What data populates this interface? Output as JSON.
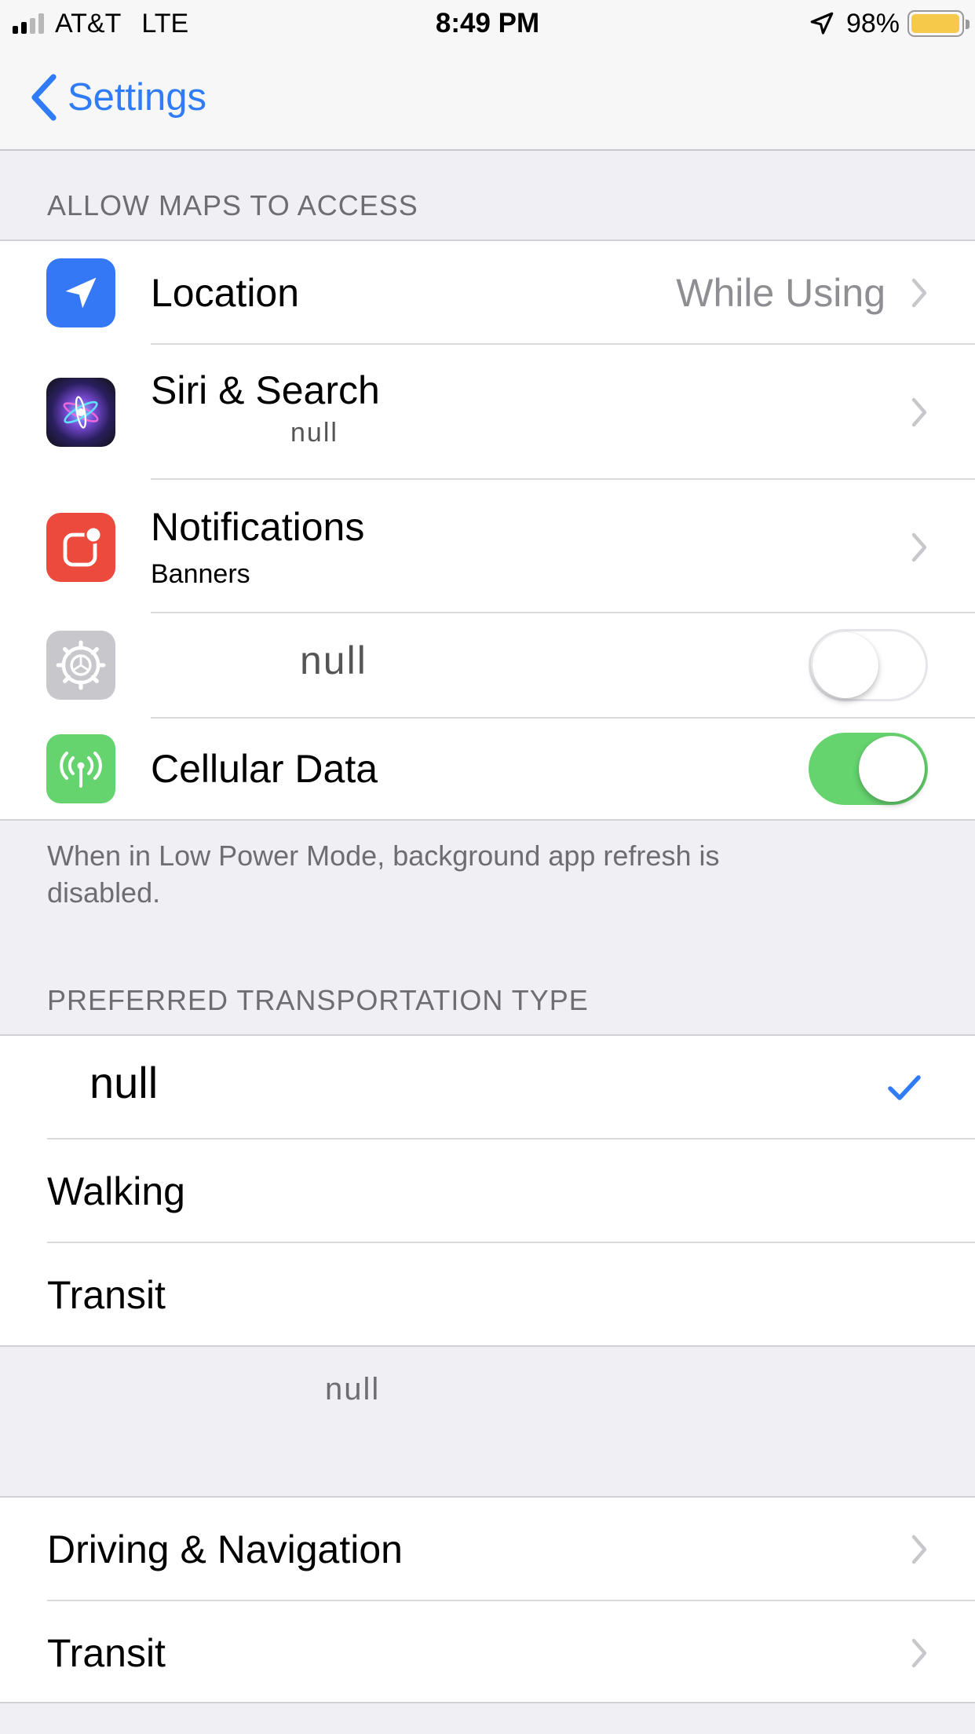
{
  "status_bar": {
    "carrier": "AT&T",
    "network": "LTE",
    "time": "8:49 PM",
    "battery_percent": "98%",
    "battery_level": 0.98,
    "battery_color": "#f6c94a",
    "signal_bars_active": 2,
    "signal_bars_total": 4
  },
  "nav": {
    "back_label": "Settings",
    "accent_color": "#2f7cf6"
  },
  "access_section": {
    "header": "ALLOW MAPS TO ACCESS",
    "items": [
      {
        "icon": "location-arrow-icon",
        "icon_color": "#3478f6",
        "title": "Location",
        "value": "While Using",
        "control": "chevron"
      },
      {
        "icon": "siri-icon",
        "title": "Siri & Search",
        "subtitle": "null",
        "control": "chevron"
      },
      {
        "icon": "notifications-icon",
        "icon_color": "#ec4a3c",
        "title": "Notifications",
        "subtitle": "Banners",
        "control": "chevron"
      },
      {
        "icon": "gear-icon",
        "icon_color": "#c8c8cc",
        "title": "null",
        "control": "toggle",
        "toggle_on": false
      },
      {
        "icon": "cellular-antenna-icon",
        "icon_color": "#65d36e",
        "title": "Cellular Data",
        "control": "toggle",
        "toggle_on": true
      }
    ],
    "footer": "When in Low Power Mode, background app refresh is disabled."
  },
  "transport_section": {
    "header": "PREFERRED TRANSPORTATION TYPE",
    "items": [
      {
        "title": "null",
        "selected": true
      },
      {
        "title": "Walking",
        "selected": false
      },
      {
        "title": "Transit",
        "selected": false
      }
    ],
    "footer": "null"
  },
  "more_section": {
    "items": [
      {
        "title": "Driving & Navigation",
        "control": "chevron"
      },
      {
        "title": "Transit",
        "control": "chevron"
      }
    ]
  }
}
